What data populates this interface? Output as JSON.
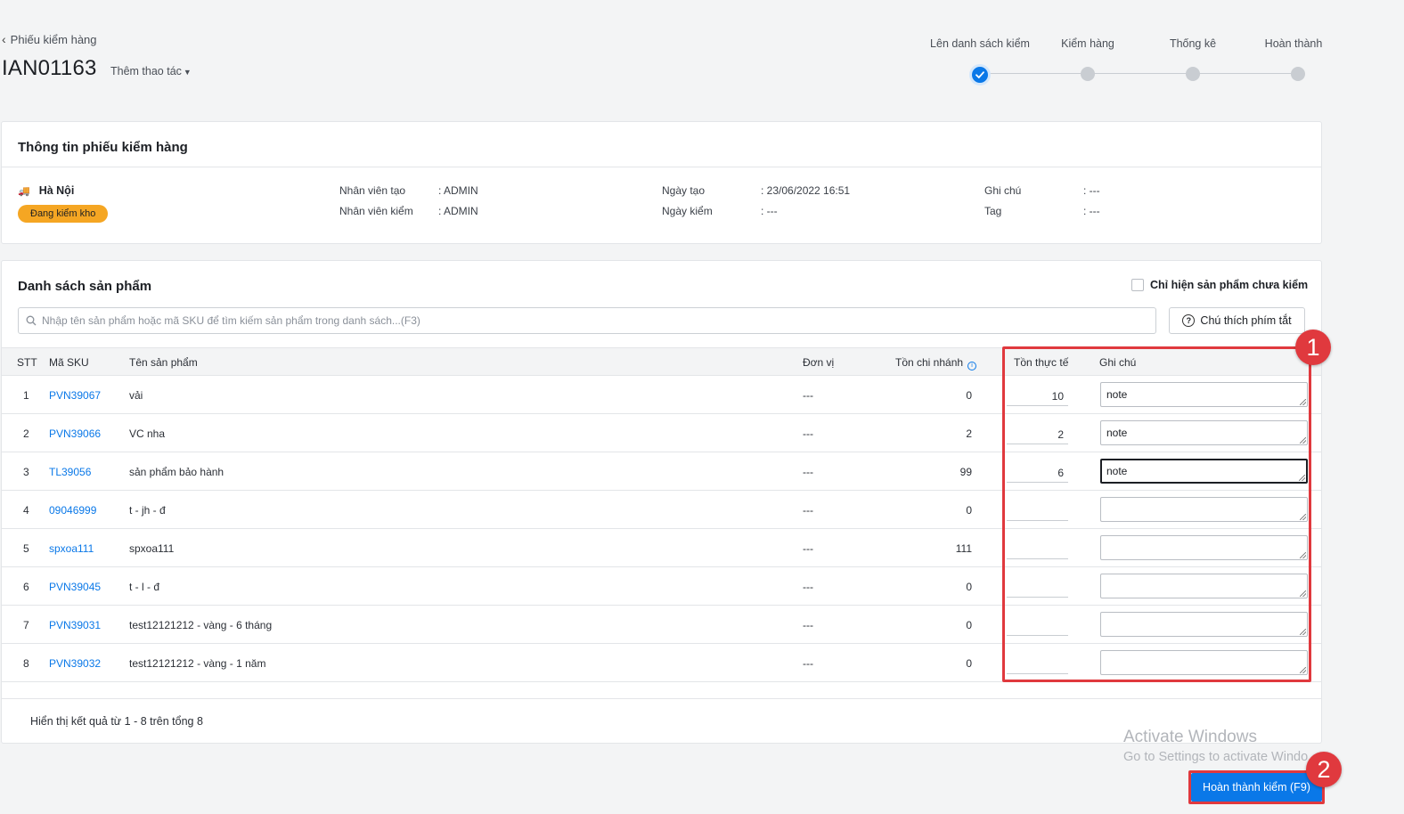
{
  "header": {
    "back_label": "Phiếu kiểm hàng",
    "code": "IAN01163",
    "more_actions": "Thêm thao tác"
  },
  "steps": [
    {
      "label": "Lên danh sách kiểm",
      "done": true
    },
    {
      "label": "Kiểm hàng",
      "done": false
    },
    {
      "label": "Thống kê",
      "done": false
    },
    {
      "label": "Hoàn thành",
      "done": false
    }
  ],
  "info_card": {
    "title": "Thông tin phiếu kiểm hàng",
    "branch": "Hà Nội",
    "status_badge": "Đang kiểm kho",
    "created_by_label": "Nhân viên tạo",
    "created_by_value": ": ADMIN",
    "checked_by_label": "Nhân viên kiểm",
    "checked_by_value": ": ADMIN",
    "created_date_label": "Ngày tạo",
    "created_date_value": ": 23/06/2022 16:51",
    "check_date_label": "Ngày kiểm",
    "check_date_value": ": ---",
    "note_label": "Ghi chú",
    "note_value": ": ---",
    "tag_label": "Tag",
    "tag_value": ": ---"
  },
  "products": {
    "title": "Danh sách sản phẩm",
    "only_unchecked_label": "Chỉ hiện sản phẩm chưa kiểm",
    "search_placeholder": "Nhập tên sản phẩm hoặc mã SKU để tìm kiếm sản phẩm trong danh sách...(F3)",
    "hotkey_button": "Chú thích phím tắt",
    "columns": {
      "stt": "STT",
      "sku": "Mã SKU",
      "name": "Tên sản phẩm",
      "unit": "Đơn vị",
      "branch_stock": "Tồn chi nhánh",
      "actual_stock": "Tồn thực tế",
      "note": "Ghi chú"
    },
    "rows": [
      {
        "stt": "1",
        "sku": "PVN39067",
        "name": "vải",
        "unit": "---",
        "branch_stock": "0",
        "actual_stock": "10",
        "note": "note"
      },
      {
        "stt": "2",
        "sku": "PVN39066",
        "name": "VC nha",
        "unit": "---",
        "branch_stock": "2",
        "actual_stock": "2",
        "note": "note"
      },
      {
        "stt": "3",
        "sku": "TL39056",
        "name": "sản phẩm bảo hành",
        "unit": "---",
        "branch_stock": "99",
        "actual_stock": "6",
        "note": "note"
      },
      {
        "stt": "4",
        "sku": "09046999",
        "name": "t - jh - đ",
        "unit": "---",
        "branch_stock": "0",
        "actual_stock": "",
        "note": ""
      },
      {
        "stt": "5",
        "sku": "spxoa111",
        "name": "spxoa111",
        "unit": "---",
        "branch_stock": "111",
        "actual_stock": "",
        "note": ""
      },
      {
        "stt": "6",
        "sku": "PVN39045",
        "name": "t - l - đ",
        "unit": "---",
        "branch_stock": "0",
        "actual_stock": "",
        "note": ""
      },
      {
        "stt": "7",
        "sku": "PVN39031",
        "name": "test12121212 - vàng - 6 tháng",
        "unit": "---",
        "branch_stock": "0",
        "actual_stock": "",
        "note": ""
      },
      {
        "stt": "8",
        "sku": "PVN39032",
        "name": "test12121212 - vàng - 1 năm",
        "unit": "---",
        "branch_stock": "0",
        "actual_stock": "",
        "note": ""
      }
    ],
    "footer": "Hiển thị kết quả từ 1 - 8 trên tổng 8"
  },
  "callouts": [
    "1",
    "2"
  ],
  "watermark": {
    "line1": "Activate Windows",
    "line2": "Go to Settings to activate Windo"
  },
  "finish_button": "Hoàn thành kiểm (F9)",
  "colors": {
    "accent": "#0a78e8",
    "badge": "#f5a623",
    "annotation": "#e0393e"
  }
}
